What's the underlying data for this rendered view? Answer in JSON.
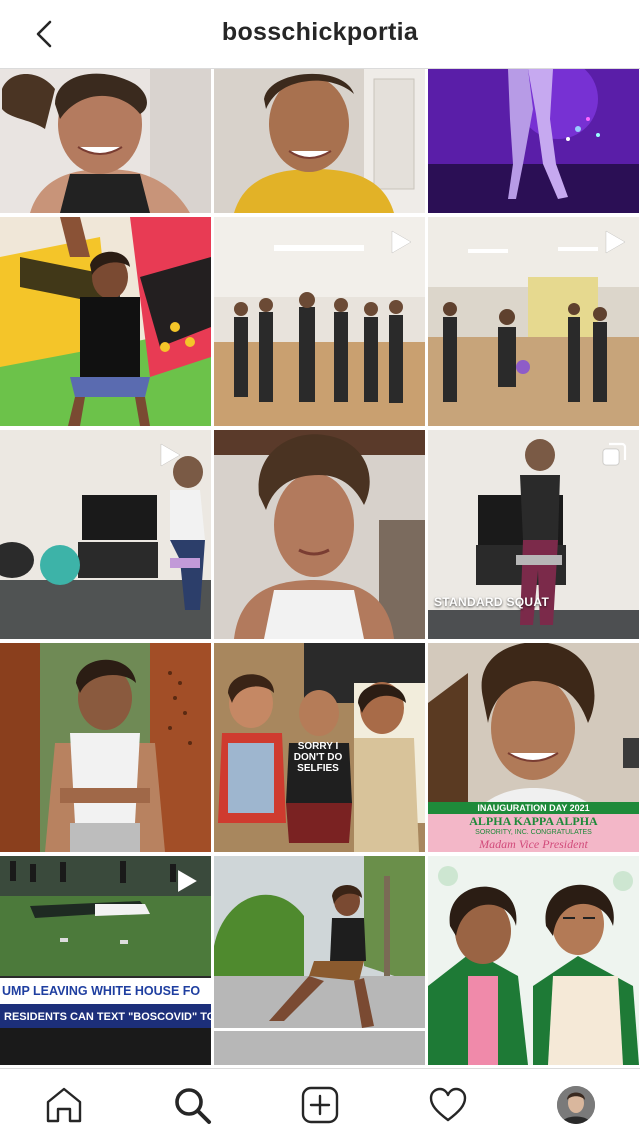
{
  "header": {
    "username": "bosschickportia",
    "back_icon": "chevron-left-icon"
  },
  "posts": [
    {
      "id": "p1",
      "type": "photo"
    },
    {
      "id": "p2",
      "type": "photo"
    },
    {
      "id": "p3",
      "type": "photo"
    },
    {
      "id": "p4",
      "type": "photo"
    },
    {
      "id": "p5",
      "type": "video"
    },
    {
      "id": "p6",
      "type": "video"
    },
    {
      "id": "p7",
      "type": "video"
    },
    {
      "id": "p8",
      "type": "photo"
    },
    {
      "id": "p9",
      "type": "carousel",
      "caption": "STANDARD SQUAT"
    },
    {
      "id": "p10",
      "type": "photo"
    },
    {
      "id": "p11",
      "type": "photo",
      "shirt_text": "SORRY I DON'T DO SELFIES"
    },
    {
      "id": "p12",
      "type": "photo",
      "banner_top": "INAUGURATION DAY 2021",
      "banner_title": "ALPHA KAPPA ALPHA",
      "banner_sub": "SORORITY, INC. CONGRATULATES",
      "banner_script": "Madam Vice President"
    },
    {
      "id": "p13",
      "type": "video",
      "headline": "UMP LEAVING WHITE HOUSE FO",
      "ticker": "RESIDENTS CAN TEXT \"BOSCOVID\" TO"
    },
    {
      "id": "p14",
      "type": "photo"
    },
    {
      "id": "p15",
      "type": "photo"
    }
  ],
  "nav": {
    "items": [
      {
        "name": "home",
        "icon": "home-icon"
      },
      {
        "name": "search",
        "icon": "search-icon",
        "active": true
      },
      {
        "name": "new-post",
        "icon": "plus-square-icon"
      },
      {
        "name": "activity",
        "icon": "heart-icon"
      },
      {
        "name": "profile",
        "icon": "avatar"
      }
    ]
  },
  "colors": {
    "border": "#dbdbdb",
    "text": "#262626",
    "aka_green": "#1e8a3a",
    "aka_pink": "#f3b7c8"
  }
}
